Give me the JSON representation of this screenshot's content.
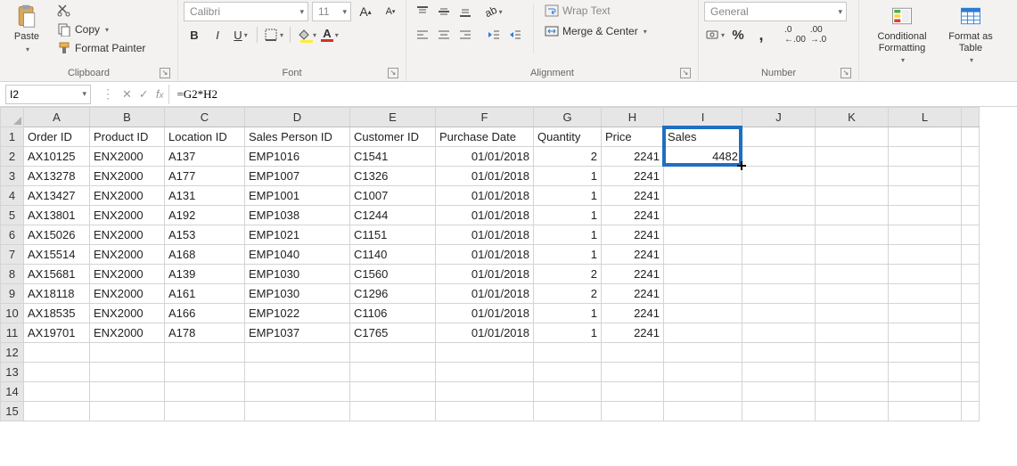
{
  "ribbon": {
    "clipboard": {
      "label": "Clipboard",
      "paste": "Paste",
      "copy": "Copy",
      "format_painter": "Format Painter"
    },
    "font": {
      "label": "Font",
      "name": "Calibri",
      "size": "11",
      "bold": "B",
      "italic": "I",
      "underline": "U"
    },
    "alignment": {
      "label": "Alignment",
      "wrap": "Wrap Text",
      "merge": "Merge & Center"
    },
    "number": {
      "label": "Number",
      "format": "General",
      "percent": "%",
      "comma": ","
    },
    "styles": {
      "conditional": "Conditional Formatting",
      "table": "Format as Table"
    }
  },
  "formula_bar": {
    "name_box": "I2",
    "formula": "=G2*H2"
  },
  "columns": [
    "A",
    "B",
    "C",
    "D",
    "E",
    "F",
    "G",
    "H",
    "I",
    "J",
    "K",
    "L",
    ""
  ],
  "headers": [
    "Order ID",
    "Product ID",
    "Location ID",
    "Sales Person ID",
    "Customer ID",
    "Purchase Date",
    "Quantity",
    "Price",
    "Sales"
  ],
  "rows": [
    {
      "n": 1
    },
    {
      "n": 2,
      "d": [
        "AX10125",
        "ENX2000",
        "A137",
        "EMP1016",
        "C1541",
        "01/01/2018",
        "2",
        "2241",
        "4482"
      ]
    },
    {
      "n": 3,
      "d": [
        "AX13278",
        "ENX2000",
        "A177",
        "EMP1007",
        "C1326",
        "01/01/2018",
        "1",
        "2241",
        ""
      ]
    },
    {
      "n": 4,
      "d": [
        "AX13427",
        "ENX2000",
        "A131",
        "EMP1001",
        "C1007",
        "01/01/2018",
        "1",
        "2241",
        ""
      ]
    },
    {
      "n": 5,
      "d": [
        "AX13801",
        "ENX2000",
        "A192",
        "EMP1038",
        "C1244",
        "01/01/2018",
        "1",
        "2241",
        ""
      ]
    },
    {
      "n": 6,
      "d": [
        "AX15026",
        "ENX2000",
        "A153",
        "EMP1021",
        "C1151",
        "01/01/2018",
        "1",
        "2241",
        ""
      ]
    },
    {
      "n": 7,
      "d": [
        "AX15514",
        "ENX2000",
        "A168",
        "EMP1040",
        "C1140",
        "01/01/2018",
        "1",
        "2241",
        ""
      ]
    },
    {
      "n": 8,
      "d": [
        "AX15681",
        "ENX2000",
        "A139",
        "EMP1030",
        "C1560",
        "01/01/2018",
        "2",
        "2241",
        ""
      ]
    },
    {
      "n": 9,
      "d": [
        "AX18118",
        "ENX2000",
        "A161",
        "EMP1030",
        "C1296",
        "01/01/2018",
        "2",
        "2241",
        ""
      ]
    },
    {
      "n": 10,
      "d": [
        "AX18535",
        "ENX2000",
        "A166",
        "EMP1022",
        "C1106",
        "01/01/2018",
        "1",
        "2241",
        ""
      ]
    },
    {
      "n": 11,
      "d": [
        "AX19701",
        "ENX2000",
        "A178",
        "EMP1037",
        "C1765",
        "01/01/2018",
        "1",
        "2241",
        ""
      ]
    },
    {
      "n": 12
    },
    {
      "n": 13
    },
    {
      "n": 14
    },
    {
      "n": 15
    }
  ],
  "selection": {
    "cell": "I2",
    "range_rows": 2
  }
}
